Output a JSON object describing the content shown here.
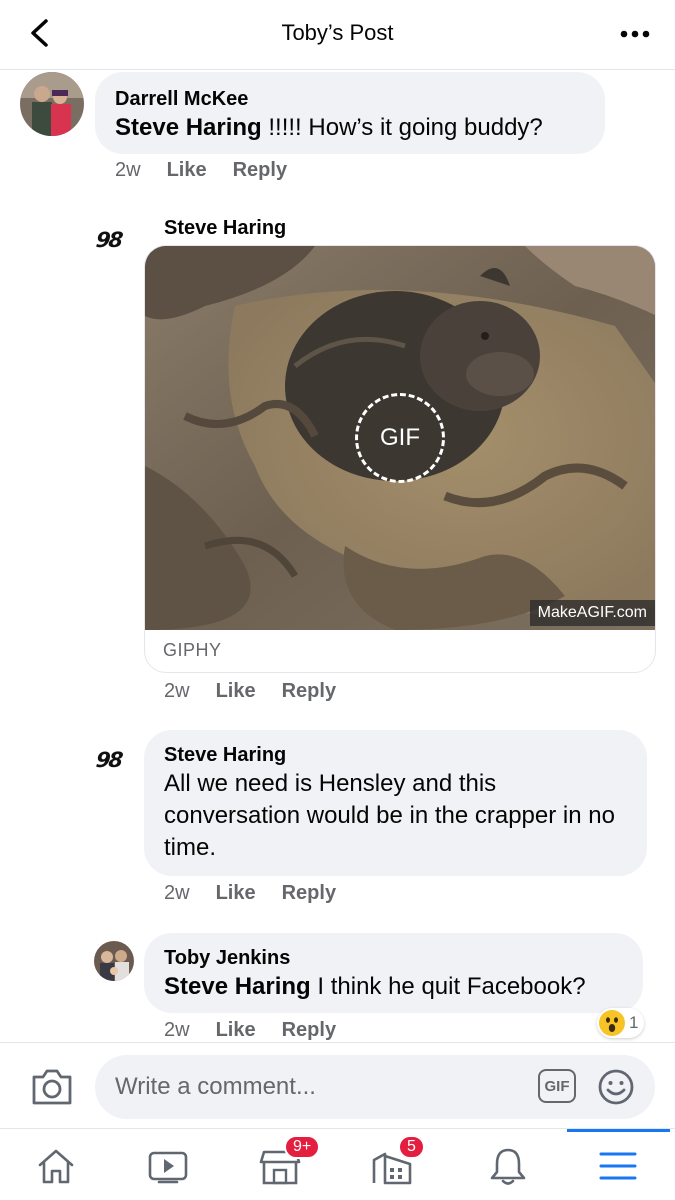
{
  "header": {
    "title": "Toby’s Post"
  },
  "comments": [
    {
      "author": "Darrell McKee",
      "mention": "Steve Haring",
      "text": " !!!!! How’s it going buddy?",
      "time": "2w",
      "like": "Like",
      "reply": "Reply"
    },
    {
      "author": "Steve Haring",
      "avatar_text": "98",
      "gif": {
        "overlay_label": "GIF",
        "watermark": "MakeAGIF.com",
        "source": "GIPHY"
      },
      "time": "2w",
      "like": "Like",
      "reply": "Reply"
    },
    {
      "author": "Steve Haring",
      "avatar_text": "98",
      "text": "All we need is Hensley and this conversation would be in the crapper in no time.",
      "time": "2w",
      "like": "Like",
      "reply": "Reply"
    },
    {
      "author": "Toby Jenkins",
      "mention": "Steve Haring",
      "text": " I think he quit Facebook?",
      "time": "2w",
      "like": "Like",
      "reply": "Reply",
      "reaction": {
        "emoji": "wow",
        "count": "1"
      }
    }
  ],
  "composer": {
    "placeholder": "Write a comment...",
    "gif_label": "GIF"
  },
  "tabbar": {
    "marketplace_badge": "9+",
    "groups_badge": "5"
  },
  "colors": {
    "accent": "#1877f2",
    "badge": "#e41e3f",
    "bubble": "#f0f2f5",
    "secondary_text": "#65676b"
  }
}
